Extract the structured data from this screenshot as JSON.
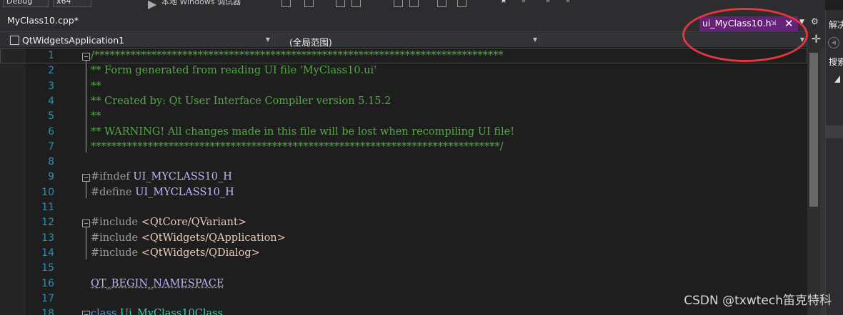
{
  "toolbar": {
    "config_label": "Debug",
    "platform_label": "x64",
    "target_label": "本地 Windows 调试器"
  },
  "tabs": {
    "main": "MyClass10.cpp*",
    "preview": "ui_MyClass10.h",
    "preview_close": "✕",
    "preview_pin": "⇲"
  },
  "nav": {
    "project": "QtWidgetsApplication1",
    "scope": "(全局范围)",
    "member": ""
  },
  "editor": {
    "lines": [
      {
        "n": "1",
        "parts": [
          {
            "t": "/*******************************************************************************",
            "c": "t-c"
          }
        ]
      },
      {
        "n": "2",
        "parts": [
          {
            "t": "** Form generated from reading UI file 'MyClass10.ui'",
            "c": "t-c"
          }
        ]
      },
      {
        "n": "3",
        "parts": [
          {
            "t": "**",
            "c": "t-c"
          }
        ]
      },
      {
        "n": "4",
        "parts": [
          {
            "t": "** Created by: Qt User Interface Compiler version 5.15.2",
            "c": "t-c"
          }
        ]
      },
      {
        "n": "5",
        "parts": [
          {
            "t": "**",
            "c": "t-c"
          }
        ]
      },
      {
        "n": "6",
        "parts": [
          {
            "t": "** WARNING! All changes made in this file will be lost when recompiling UI file!",
            "c": "t-c"
          }
        ]
      },
      {
        "n": "7",
        "parts": [
          {
            "t": "*******************************************************************************/",
            "c": "t-c"
          }
        ]
      },
      {
        "n": "8",
        "parts": []
      },
      {
        "n": "9",
        "parts": [
          {
            "t": "#ifndef ",
            "c": "t-pp"
          },
          {
            "t": "UI_MYCLASS10_H",
            "c": "t-m"
          }
        ]
      },
      {
        "n": "10",
        "parts": [
          {
            "t": "#define ",
            "c": "t-pp"
          },
          {
            "t": "UI_MYCLASS10_H",
            "c": "t-m"
          }
        ]
      },
      {
        "n": "11",
        "parts": []
      },
      {
        "n": "12",
        "parts": [
          {
            "t": "#include ",
            "c": "t-pp"
          },
          {
            "t": "<QtCore/QVariant>",
            "c": "t-s"
          }
        ]
      },
      {
        "n": "13",
        "parts": [
          {
            "t": "#include ",
            "c": "t-pp"
          },
          {
            "t": "<QtWidgets/QApplication>",
            "c": "t-s"
          }
        ]
      },
      {
        "n": "14",
        "parts": [
          {
            "t": "#include ",
            "c": "t-pp"
          },
          {
            "t": "<QtWidgets/QDialog>",
            "c": "t-s"
          }
        ]
      },
      {
        "n": "15",
        "parts": []
      },
      {
        "n": "16",
        "parts": [
          {
            "t": "QT_BEGIN_NAMESPACE",
            "c": "t-mm"
          }
        ]
      },
      {
        "n": "17",
        "parts": []
      },
      {
        "n": "18",
        "parts": [
          {
            "t": "class ",
            "c": "t-k"
          },
          {
            "t": "Ui_MyClass10Class",
            "c": "t-ty"
          }
        ]
      }
    ]
  },
  "right_panel": {
    "title": "解决方案资源管理器",
    "search": "搜索解决方案资源管理器"
  },
  "watermark": "CSDN @txwtech笛克特科",
  "colors": {
    "editor_bg": "#1e1e1e",
    "preview_tab": "#68217a",
    "line_number": "#2b91af",
    "comment": "#57a64a",
    "annotation_circle": "#e5363b"
  }
}
